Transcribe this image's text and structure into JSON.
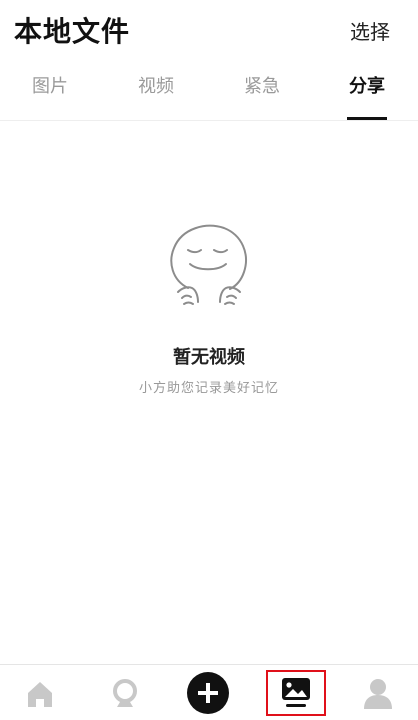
{
  "header": {
    "title": "本地文件",
    "select_label": "选择"
  },
  "tabs": [
    {
      "label": "图片",
      "active": false
    },
    {
      "label": "视频",
      "active": false
    },
    {
      "label": "紧急",
      "active": false
    },
    {
      "label": "分享",
      "active": true
    }
  ],
  "empty_state": {
    "title": "暂无视频",
    "subtitle": "小方助您记录美好记忆",
    "illustration": "smiling-face-icon"
  },
  "bottom_nav": {
    "items": [
      {
        "icon": "home-icon",
        "active": false
      },
      {
        "icon": "camera-icon",
        "active": false
      },
      {
        "icon": "add-icon",
        "active": false
      },
      {
        "icon": "gallery-icon",
        "active": true
      },
      {
        "icon": "profile-icon",
        "active": false
      }
    ],
    "highlight_color": "#e0101a"
  },
  "colors": {
    "text_primary": "#111111",
    "text_inactive": "#9a9a9a",
    "icon_inactive": "#c8c8c8",
    "accent_dark": "#111111"
  }
}
